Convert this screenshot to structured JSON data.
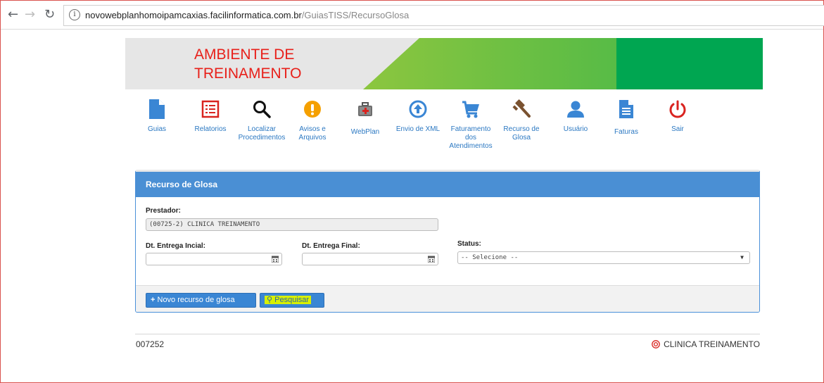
{
  "browser": {
    "url_host": "novowebplanhomoipamcaxias.facilinformatica.com.br",
    "url_path": "/GuiasTISS/RecursoGlosa",
    "info_glyph": "i"
  },
  "banner": {
    "title": "AMBIENTE DE TREINAMENTO"
  },
  "nav": {
    "items": [
      {
        "label": "Guias",
        "icon": "document-icon"
      },
      {
        "label": "Relatorios",
        "icon": "list-icon"
      },
      {
        "label": "Localizar Procedimentos",
        "icon": "search-icon"
      },
      {
        "label": "Avisos e Arquivos",
        "icon": "alert-icon"
      },
      {
        "label": "WebPlan",
        "icon": "medkit-icon"
      },
      {
        "label": "Envio de XML",
        "icon": "upload-icon"
      },
      {
        "label": "Faturamento dos Atendimentos",
        "icon": "cart-icon"
      },
      {
        "label": "Recurso de Glosa",
        "icon": "gavel-icon"
      },
      {
        "label": "Usuário",
        "icon": "user-icon"
      },
      {
        "label": "Faturas",
        "icon": "invoice-icon"
      },
      {
        "label": "Sair",
        "icon": "power-icon"
      }
    ]
  },
  "panel": {
    "title": "Recurso de Glosa",
    "prestador_label": "Prestador:",
    "prestador_value": "(00725-2) CLINICA TREINAMENTO",
    "dt_inicial_label": "Dt. Entrega Incial:",
    "dt_inicial_value": "",
    "dt_final_label": "Dt. Entrega Final:",
    "dt_final_value": "",
    "status_label": "Status:",
    "status_selected": "-- Selecione --",
    "new_button": "Novo recurso de glosa",
    "search_button": "Pesquisar"
  },
  "footer": {
    "code": "007252",
    "clinic": "CLINICA TREINAMENTO"
  },
  "colors": {
    "accent_blue": "#4a8fd4",
    "banner_green": "#00a651",
    "banner_title": "#e8201a",
    "icon_blue": "#3a86d4",
    "icon_red": "#d9231f",
    "icon_orange": "#f5a000"
  }
}
